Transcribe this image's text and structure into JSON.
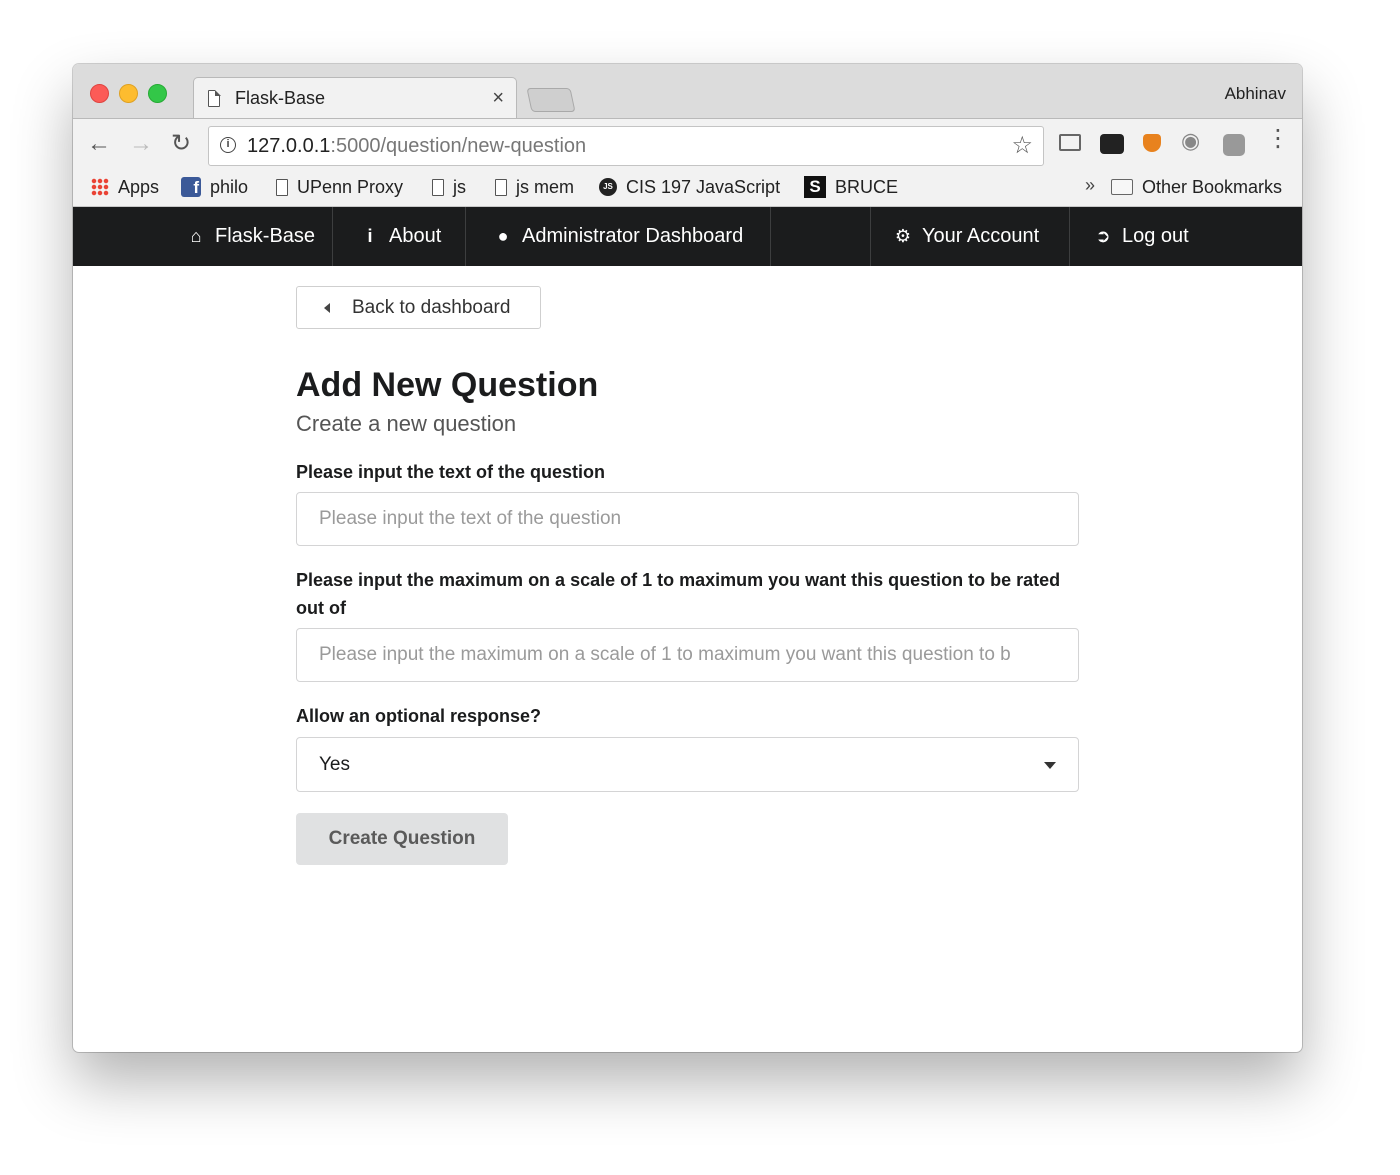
{
  "browser": {
    "tab_title": "Flask-Base",
    "tab_close": "×",
    "profile_name": "Abhinav",
    "url_host": "127.0.0.1",
    "url_path": ":5000/question/new-question",
    "bookmarks": [
      {
        "label": "Apps",
        "icon": "apps-grid-icon"
      },
      {
        "label": "philo",
        "icon": "facebook-icon"
      },
      {
        "label": "UPenn Proxy",
        "icon": "page-icon"
      },
      {
        "label": "js",
        "icon": "page-icon"
      },
      {
        "label": "js mem",
        "icon": "page-icon"
      },
      {
        "label": "CIS 197 JavaScript",
        "icon": "js-badge-icon"
      },
      {
        "label": "BRUCE",
        "icon": "s-logo-icon"
      }
    ],
    "bookmarks_overflow": "»",
    "other_bookmarks": "Other Bookmarks"
  },
  "navbar": {
    "items": [
      {
        "label": "Flask-Base",
        "icon": "home-icon"
      },
      {
        "label": "About",
        "icon": "info-icon"
      },
      {
        "label": "Administrator Dashboard",
        "icon": "user-icon"
      },
      {
        "label": "Your Account",
        "icon": "settings-icon"
      },
      {
        "label": "Log out",
        "icon": "sign-out-icon"
      }
    ],
    "background": "#1b1c1d"
  },
  "page": {
    "back_label": "Back to dashboard",
    "title": "Add New Question",
    "subtitle": "Create a new question"
  },
  "form": {
    "question_text": {
      "label": "Please input the text of the question",
      "placeholder": "Please input the text of the question",
      "value": ""
    },
    "max_rating": {
      "label": "Please input the maximum on a scale of 1 to maximum you want this question to be rated out of",
      "placeholder": "Please input the maximum on a scale of 1 to maximum you want this question to b",
      "value": ""
    },
    "optional_response": {
      "label": "Allow an optional response?",
      "selected": "Yes"
    },
    "submit_label": "Create Question"
  },
  "colors": {
    "accent_dark": "#1b1c1d",
    "button_grey": "#e0e1e2"
  }
}
